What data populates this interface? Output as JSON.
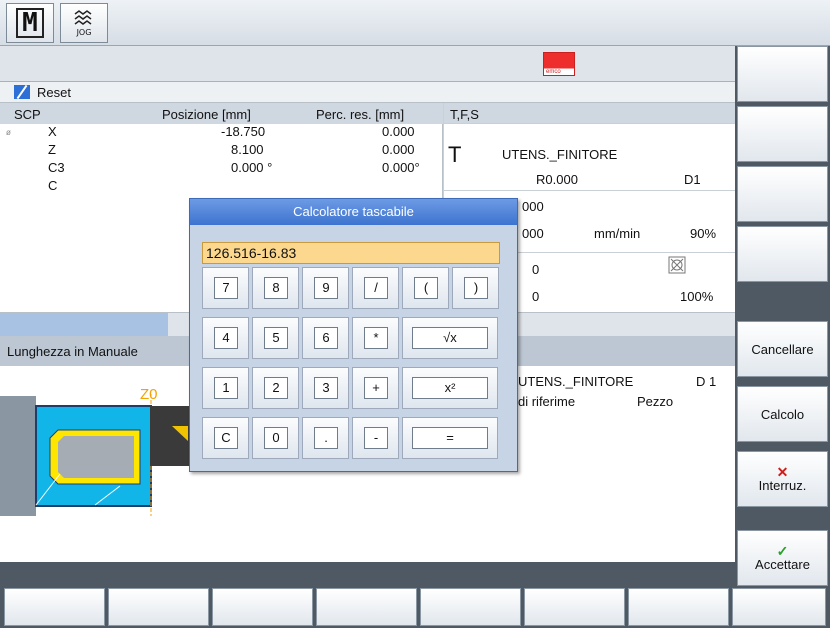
{
  "top": {
    "jog_label": "JOG"
  },
  "reset_label": "Reset",
  "position": {
    "header": {
      "scp": "SCP",
      "pos": "Posizione [mm]",
      "perc": "Perc. res. [mm]"
    },
    "axes": [
      {
        "name": "X",
        "pos": "-18.750",
        "res": "0.000"
      },
      {
        "name": "Z",
        "pos": "8.100",
        "res": "0.000"
      },
      {
        "name": "C3",
        "pos": "0.000 °",
        "res": "0.000°"
      },
      {
        "name": "C",
        "pos": "",
        "res": ""
      }
    ]
  },
  "tfs": {
    "header": "T,F,S",
    "t_letter": "T",
    "tool": "UTENS._FINITORE",
    "radius": "R0.000",
    "d": "D1",
    "f_val1": "000",
    "f_val2": "000",
    "f_unit": "mm/min",
    "f_pct": "90%",
    "s_val1": "0",
    "s_val2": "0",
    "s_pct": "100%"
  },
  "panel_title": "Lunghezza in Manuale",
  "work": {
    "z0_label": "Z0",
    "tool": "UTENS._FINITORE",
    "d": "D 1",
    "ref_label": "di riferime",
    "workpiece": "Pezzo"
  },
  "right_softkeys": [
    "Cancellare",
    "Calcolo",
    "Interruz.",
    "Accettare"
  ],
  "calculator": {
    "title": "Calcolatore tascabile",
    "input_value": "126.516-16.83",
    "rows": [
      [
        "7",
        "8",
        "9",
        "/",
        "(",
        ")"
      ],
      [
        "4",
        "5",
        "6",
        "*",
        "√x"
      ],
      [
        "1",
        "2",
        "3",
        "+",
        "x²"
      ],
      [
        "C",
        "0",
        ".",
        "-",
        "="
      ]
    ]
  },
  "colors": {
    "accent": "#3d74d0",
    "input": "#fbd88e",
    "brand_red": "#ee2d2d"
  }
}
